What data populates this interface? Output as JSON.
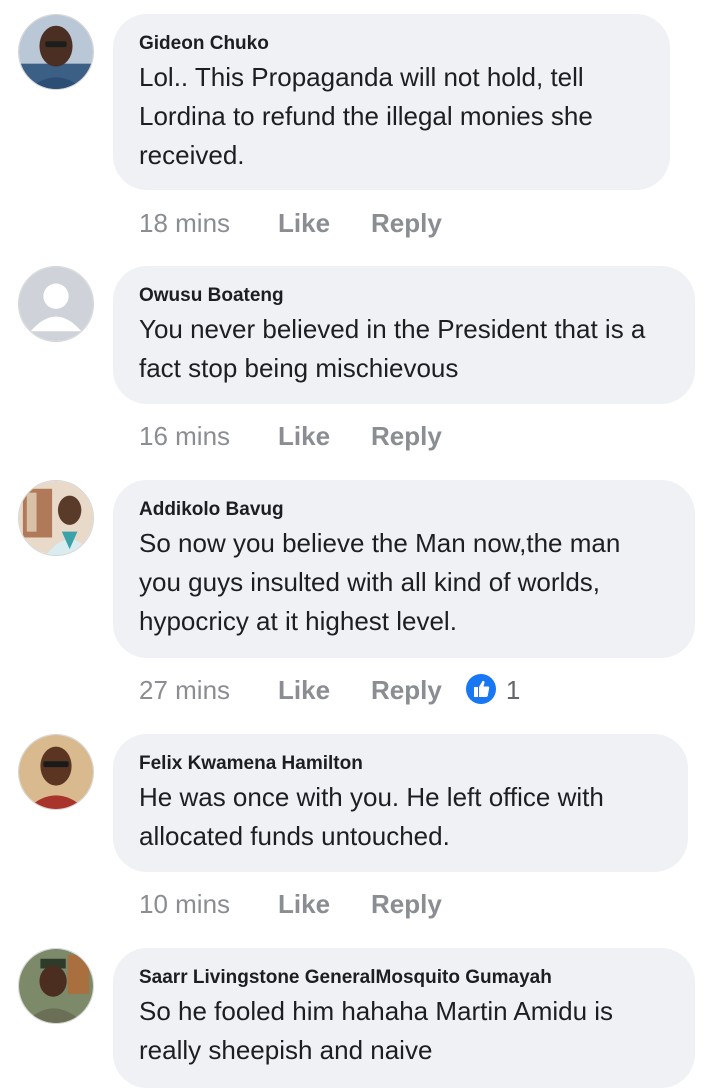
{
  "comments": [
    {
      "author": "Gideon Chuko",
      "text": "Lol.. This Propaganda will not hold, tell Lordina to refund the illegal monies she received.",
      "time": "18 mins",
      "like_label": "Like",
      "reply_label": "Reply"
    },
    {
      "author": "Owusu Boateng",
      "text": "You never believed in the President that is a fact stop being mischievous",
      "time": "16 mins",
      "like_label": "Like",
      "reply_label": "Reply"
    },
    {
      "author": "Addikolo Bavug",
      "text": "So now you believe the Man now,the man you guys insulted with all kind of worlds, hypocricy at it highest level.",
      "time": "27 mins",
      "like_label": "Like",
      "reply_label": "Reply",
      "reaction_count": "1"
    },
    {
      "author": "Felix Kwamena Hamilton",
      "text": "He was once with you. He left office with allocated funds untouched.",
      "time": "10 mins",
      "like_label": "Like",
      "reply_label": "Reply"
    },
    {
      "author": "Saarr Livingstone GeneralMosquito Gumayah",
      "text": "So he fooled him hahaha Martin Amidu is really sheepish and naive"
    }
  ],
  "colors": {
    "bubble": "#f0f1f4",
    "meta": "#8a8d91",
    "like_blue": "#1877f2"
  },
  "icons": {
    "reaction": "thumbs-up-icon",
    "default_avatar": "default-user-icon"
  }
}
